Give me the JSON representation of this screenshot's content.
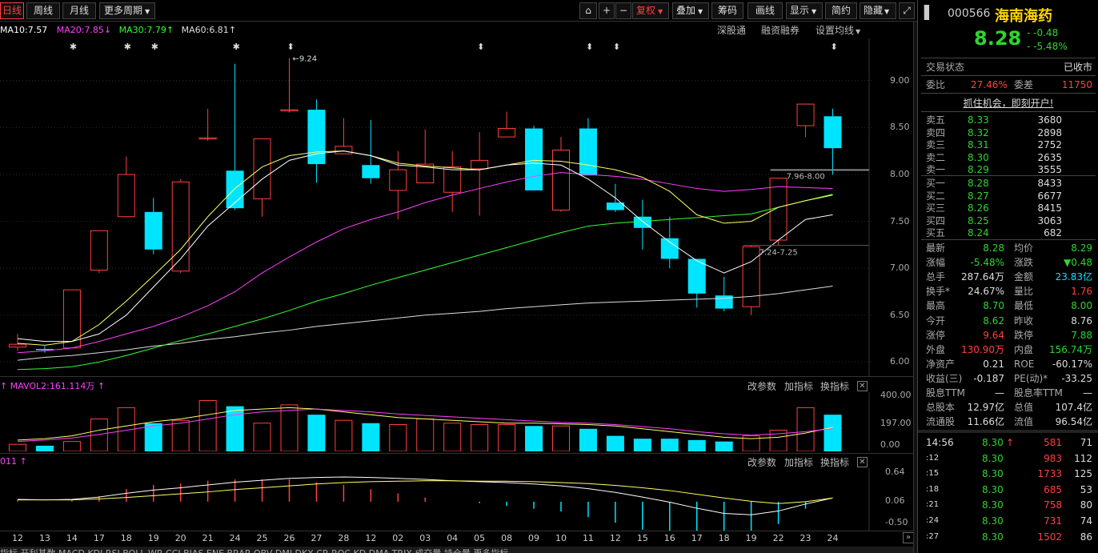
{
  "toolbar": {
    "period_day": "日线",
    "period_week": "周线",
    "period_month": "月线",
    "more_periods": "更多周期",
    "add": "+",
    "minus": "−",
    "fuquan": "复权",
    "overlay": "叠加",
    "chips": "筹码",
    "draw": "画线",
    "display": "显示",
    "simple": "简约",
    "hide": "隐藏"
  },
  "legend": {
    "ma10": "MA10:7.57",
    "ma20": "MA20:7.85",
    "ma30": "MA30:7.79",
    "ma60": "MA60:6.81",
    "colors": {
      "ma10": "#ffffff",
      "ma20": "#ff40ff",
      "ma30": "#33ff33",
      "ma60": "#dddddd",
      "ma5": "#ffff66",
      "up": "#ff4040",
      "down": "#00e5ff"
    }
  },
  "links": {
    "sgt": "深股通",
    "rzrq": "融资融券",
    "set_ma": "设置均线"
  },
  "chart_notes": {
    "high": "9.24",
    "box_high": "7.96-8.00",
    "box_low": "7.24-7.25"
  },
  "price_axis": [
    "9.00",
    "8.50",
    "8.00",
    "7.50",
    "7.00",
    "6.50",
    "6.00"
  ],
  "volume": {
    "legend": "MAVOL2:161.114万",
    "axis": [
      "400.00",
      "197.00",
      "0.00"
    ],
    "params": "改参数",
    "add_ind": "加指标",
    "switch_ind": "换指标"
  },
  "macd": {
    "legend": "011",
    "axis": [
      "0.64",
      "0.06",
      "-0.50"
    ],
    "params": "改参数",
    "add_ind": "加指标",
    "switch_ind": "换指标"
  },
  "dates": [
    "12",
    "13",
    "14",
    "17",
    "18",
    "19",
    "20",
    "21",
    "24",
    "25",
    "26",
    "27",
    "28",
    "12",
    "02",
    "03",
    "04",
    "05",
    "08",
    "09",
    "10",
    "11",
    "12",
    "15",
    "16",
    "17",
    "18",
    "19",
    "22",
    "23",
    "24"
  ],
  "bottom_tabs": "指标  开利基数  MACD  KDJ  RSI  BOLL  WR  CCI  BIAS  ENE  BRAR  OBV  DMI  DKX  CR  ROC  KD  DMA  TRIX  成交量  持仓量  更多指标",
  "quote": {
    "code": "000566",
    "name": "海南海药",
    "price": "8.28",
    "change": "-0.48",
    "change_pct": "-5.48%",
    "status_label": "交易状态",
    "status": "已收市",
    "wb_label": "委比",
    "wb": "27.46%",
    "wc_label": "委差",
    "wc": "11750",
    "promo": "抓住机会，即刻开户!"
  },
  "asks": [
    {
      "label": "卖五",
      "price": "8.33",
      "vol": "3680"
    },
    {
      "label": "卖四",
      "price": "8.32",
      "vol": "2898"
    },
    {
      "label": "卖三",
      "price": "8.31",
      "vol": "2752"
    },
    {
      "label": "卖二",
      "price": "8.30",
      "vol": "2635"
    },
    {
      "label": "卖一",
      "price": "8.29",
      "vol": "3555"
    }
  ],
  "bids": [
    {
      "label": "买一",
      "price": "8.28",
      "vol": "8433"
    },
    {
      "label": "买二",
      "price": "8.27",
      "vol": "6677"
    },
    {
      "label": "买三",
      "price": "8.26",
      "vol": "8415"
    },
    {
      "label": "买四",
      "price": "8.25",
      "vol": "3063"
    },
    {
      "label": "买五",
      "price": "8.24",
      "vol": "682"
    }
  ],
  "stats": [
    {
      "l1": "最新",
      "v1": "8.28",
      "c1": "dn",
      "l2": "均价",
      "v2": "8.29",
      "c2": "dn"
    },
    {
      "l1": "涨幅",
      "v1": "-5.48%",
      "c1": "dn",
      "l2": "涨跌",
      "v2": "▼0.48",
      "c2": "dn"
    },
    {
      "l1": "总手",
      "v1": "287.64万",
      "c1": "wh",
      "l2": "金额",
      "v2": "23.83亿",
      "c2": "cy"
    },
    {
      "l1": "换手*",
      "v1": "24.67%",
      "c1": "wh",
      "l2": "量比",
      "v2": "1.76",
      "c2": "up"
    },
    {
      "l1": "最高",
      "v1": "8.70",
      "c1": "dn",
      "l2": "最低",
      "v2": "8.00",
      "c2": "dn"
    },
    {
      "l1": "今开",
      "v1": "8.62",
      "c1": "dn",
      "l2": "昨收",
      "v2": "8.76",
      "c2": "wh"
    },
    {
      "l1": "涨停",
      "v1": "9.64",
      "c1": "up",
      "l2": "跌停",
      "v2": "7.88",
      "c2": "dn"
    },
    {
      "l1": "外盘",
      "v1": "130.90万",
      "c1": "up",
      "l2": "内盘",
      "v2": "156.74万",
      "c2": "dn"
    },
    {
      "l1": "净资产",
      "v1": "0.21",
      "c1": "wh",
      "l2": "ROE",
      "v2": "-60.17%",
      "c2": "wh"
    },
    {
      "l1": "收益(三)",
      "v1": "-0.187",
      "c1": "wh",
      "l2": "PE(动)*",
      "v2": "-33.25",
      "c2": "wh"
    },
    {
      "l1": "股息TTM",
      "v1": "—",
      "c1": "wh",
      "l2": "股息率TTM",
      "v2": "—",
      "c2": "wh"
    },
    {
      "l1": "总股本",
      "v1": "12.97亿",
      "c1": "wh",
      "l2": "总值",
      "v2": "107.4亿",
      "c2": "wh"
    },
    {
      "l1": "流通股",
      "v1": "11.66亿",
      "c1": "wh",
      "l2": "流值",
      "v2": "96.54亿",
      "c2": "wh"
    }
  ],
  "ticks": [
    {
      "time": "14:56",
      "price": "8.30",
      "vol": "581",
      "n": "71",
      "arrow": "↑"
    },
    {
      "time": ":12",
      "price": "8.30",
      "vol": "983",
      "n": "112",
      "arrow": ""
    },
    {
      "time": ":15",
      "price": "8.30",
      "vol": "1733",
      "n": "125",
      "arrow": ""
    },
    {
      "time": ":18",
      "price": "8.30",
      "vol": "685",
      "n": "53",
      "arrow": ""
    },
    {
      "time": ":21",
      "price": "8.30",
      "vol": "758",
      "n": "80",
      "arrow": ""
    },
    {
      "time": ":24",
      "price": "8.30",
      "vol": "731",
      "n": "74",
      "arrow": ""
    },
    {
      "time": ":27",
      "price": "8.30",
      "vol": "1502",
      "n": "86",
      "arrow": ""
    }
  ],
  "chart_data": {
    "type": "candlestick",
    "ylim": [
      5.85,
      9.45
    ],
    "candles": [
      {
        "o": 6.16,
        "c": 6.19,
        "h": 6.3,
        "l": 6.12
      },
      {
        "o": 6.14,
        "c": 6.13,
        "h": 6.17,
        "l": 6.1
      },
      {
        "o": 6.15,
        "c": 6.77,
        "h": 6.77,
        "l": 6.15
      },
      {
        "o": 6.98,
        "c": 7.4,
        "h": 7.4,
        "l": 6.95
      },
      {
        "o": 7.55,
        "c": 8.0,
        "h": 8.19,
        "l": 7.55
      },
      {
        "o": 7.6,
        "c": 7.2,
        "h": 7.75,
        "l": 7.15
      },
      {
        "o": 6.97,
        "c": 7.92,
        "h": 7.95,
        "l": 6.95
      },
      {
        "o": 8.39,
        "c": 8.39,
        "h": 8.7,
        "l": 8.36
      },
      {
        "o": 8.04,
        "c": 7.64,
        "h": 9.18,
        "l": 7.62
      },
      {
        "o": 7.74,
        "c": 8.38,
        "h": 8.38,
        "l": 7.55
      },
      {
        "o": 8.69,
        "c": 8.69,
        "h": 9.24,
        "l": 8.66
      },
      {
        "o": 8.69,
        "c": 8.11,
        "h": 8.8,
        "l": 7.91
      },
      {
        "o": 8.22,
        "c": 8.3,
        "h": 8.6,
        "l": 8.22
      },
      {
        "o": 8.1,
        "c": 7.96,
        "h": 8.58,
        "l": 7.9
      },
      {
        "o": 7.83,
        "c": 8.05,
        "h": 8.25,
        "l": 7.52
      },
      {
        "o": 7.91,
        "c": 8.11,
        "h": 8.48,
        "l": 7.91
      },
      {
        "o": 7.81,
        "c": 8.08,
        "h": 8.25,
        "l": 7.6
      },
      {
        "o": 8.06,
        "c": 8.15,
        "h": 8.45,
        "l": 7.56
      },
      {
        "o": 8.4,
        "c": 8.49,
        "h": 8.67,
        "l": 8.4
      },
      {
        "o": 8.49,
        "c": 7.83,
        "h": 8.52,
        "l": 7.83
      },
      {
        "o": 7.62,
        "c": 8.26,
        "h": 8.4,
        "l": 7.6
      },
      {
        "o": 8.49,
        "c": 7.99,
        "h": 8.6,
        "l": 7.99
      },
      {
        "o": 7.7,
        "c": 7.62,
        "h": 7.9,
        "l": 7.6
      },
      {
        "o": 7.55,
        "c": 7.43,
        "h": 7.73,
        "l": 7.2
      },
      {
        "o": 7.32,
        "c": 7.1,
        "h": 7.55,
        "l": 7.0
      },
      {
        "o": 7.1,
        "c": 6.73,
        "h": 7.1,
        "l": 6.58
      },
      {
        "o": 6.71,
        "c": 6.57,
        "h": 6.91,
        "l": 6.54
      },
      {
        "o": 6.59,
        "c": 7.23,
        "h": 7.24,
        "l": 6.5
      },
      {
        "o": 7.3,
        "c": 7.96,
        "h": 7.96,
        "l": 7.24
      },
      {
        "o": 8.52,
        "c": 8.75,
        "h": 8.75,
        "l": 8.4
      },
      {
        "o": 8.62,
        "c": 8.28,
        "h": 8.7,
        "l": 8.0
      }
    ],
    "ma5": [
      6.2,
      6.18,
      6.22,
      6.4,
      6.65,
      6.92,
      7.2,
      7.55,
      7.85,
      8.08,
      8.2,
      8.24,
      8.25,
      8.2,
      8.12,
      8.09,
      8.07,
      8.05,
      8.1,
      8.15,
      8.14,
      8.1,
      8.05,
      7.97,
      7.82,
      7.57,
      7.48,
      7.5,
      7.65,
      7.72,
      7.78
    ],
    "ma10": [
      6.25,
      6.22,
      6.22,
      6.3,
      6.5,
      6.8,
      7.1,
      7.45,
      7.7,
      7.95,
      8.15,
      8.22,
      8.25,
      8.2,
      8.1,
      8.08,
      8.05,
      8.05,
      8.1,
      8.12,
      8.1,
      7.95,
      7.75,
      7.5,
      7.28,
      7.08,
      6.95,
      7.07,
      7.3,
      7.52,
      7.57
    ],
    "ma20": [
      6.1,
      6.12,
      6.15,
      6.22,
      6.3,
      6.38,
      6.48,
      6.6,
      6.75,
      6.95,
      7.12,
      7.28,
      7.42,
      7.52,
      7.6,
      7.7,
      7.78,
      7.85,
      7.92,
      7.98,
      8.02,
      8.0,
      7.98,
      7.95,
      7.9,
      7.85,
      7.82,
      7.84,
      7.87,
      7.86,
      7.85
    ],
    "ma30": [
      5.92,
      5.93,
      5.95,
      6.0,
      6.07,
      6.15,
      6.23,
      6.3,
      6.38,
      6.46,
      6.55,
      6.65,
      6.73,
      6.82,
      6.9,
      6.98,
      7.06,
      7.14,
      7.22,
      7.3,
      7.38,
      7.45,
      7.48,
      7.5,
      7.52,
      7.54,
      7.56,
      7.58,
      7.65,
      7.72,
      7.79
    ],
    "ma60": [
      6.02,
      6.05,
      6.07,
      6.1,
      6.13,
      6.17,
      6.2,
      6.24,
      6.27,
      6.31,
      6.34,
      6.38,
      6.41,
      6.44,
      6.47,
      6.5,
      6.52,
      6.54,
      6.57,
      6.59,
      6.61,
      6.63,
      6.64,
      6.65,
      6.66,
      6.67,
      6.68,
      6.7,
      6.73,
      6.77,
      6.81
    ],
    "volumes": [
      50,
      40,
      70,
      230,
      310,
      200,
      220,
      360,
      320,
      200,
      330,
      260,
      220,
      200,
      190,
      230,
      200,
      190,
      190,
      180,
      180,
      160,
      110,
      90,
      90,
      80,
      70,
      110,
      150,
      310,
      260
    ],
    "mavol1": [
      80,
      90,
      110,
      150,
      180,
      210,
      230,
      260,
      290,
      300,
      310,
      300,
      280,
      260,
      240,
      230,
      220,
      210,
      200,
      200,
      195,
      190,
      180,
      160,
      140,
      120,
      100,
      90,
      100,
      130,
      170
    ],
    "mavol2": [
      70,
      80,
      95,
      120,
      150,
      180,
      200,
      230,
      260,
      280,
      290,
      300,
      290,
      280,
      265,
      255,
      245,
      235,
      225,
      215,
      205,
      200,
      190,
      175,
      160,
      140,
      125,
      115,
      125,
      140,
      161
    ],
    "dif": [
      0.05,
      0.04,
      0.05,
      0.1,
      0.18,
      0.25,
      0.3,
      0.36,
      0.42,
      0.46,
      0.5,
      0.52,
      0.53,
      0.52,
      0.5,
      0.48,
      0.45,
      0.43,
      0.41,
      0.38,
      0.34,
      0.28,
      0.2,
      0.1,
      -0.01,
      -0.14,
      -0.25,
      -0.28,
      -0.2,
      -0.05,
      0.08
    ],
    "dea": [
      0.04,
      0.04,
      0.04,
      0.06,
      0.09,
      0.13,
      0.17,
      0.21,
      0.26,
      0.3,
      0.34,
      0.38,
      0.41,
      0.43,
      0.44,
      0.45,
      0.45,
      0.44,
      0.44,
      0.43,
      0.41,
      0.39,
      0.35,
      0.3,
      0.24,
      0.16,
      0.08,
      0.01,
      -0.04,
      0.0,
      0.08
    ]
  }
}
